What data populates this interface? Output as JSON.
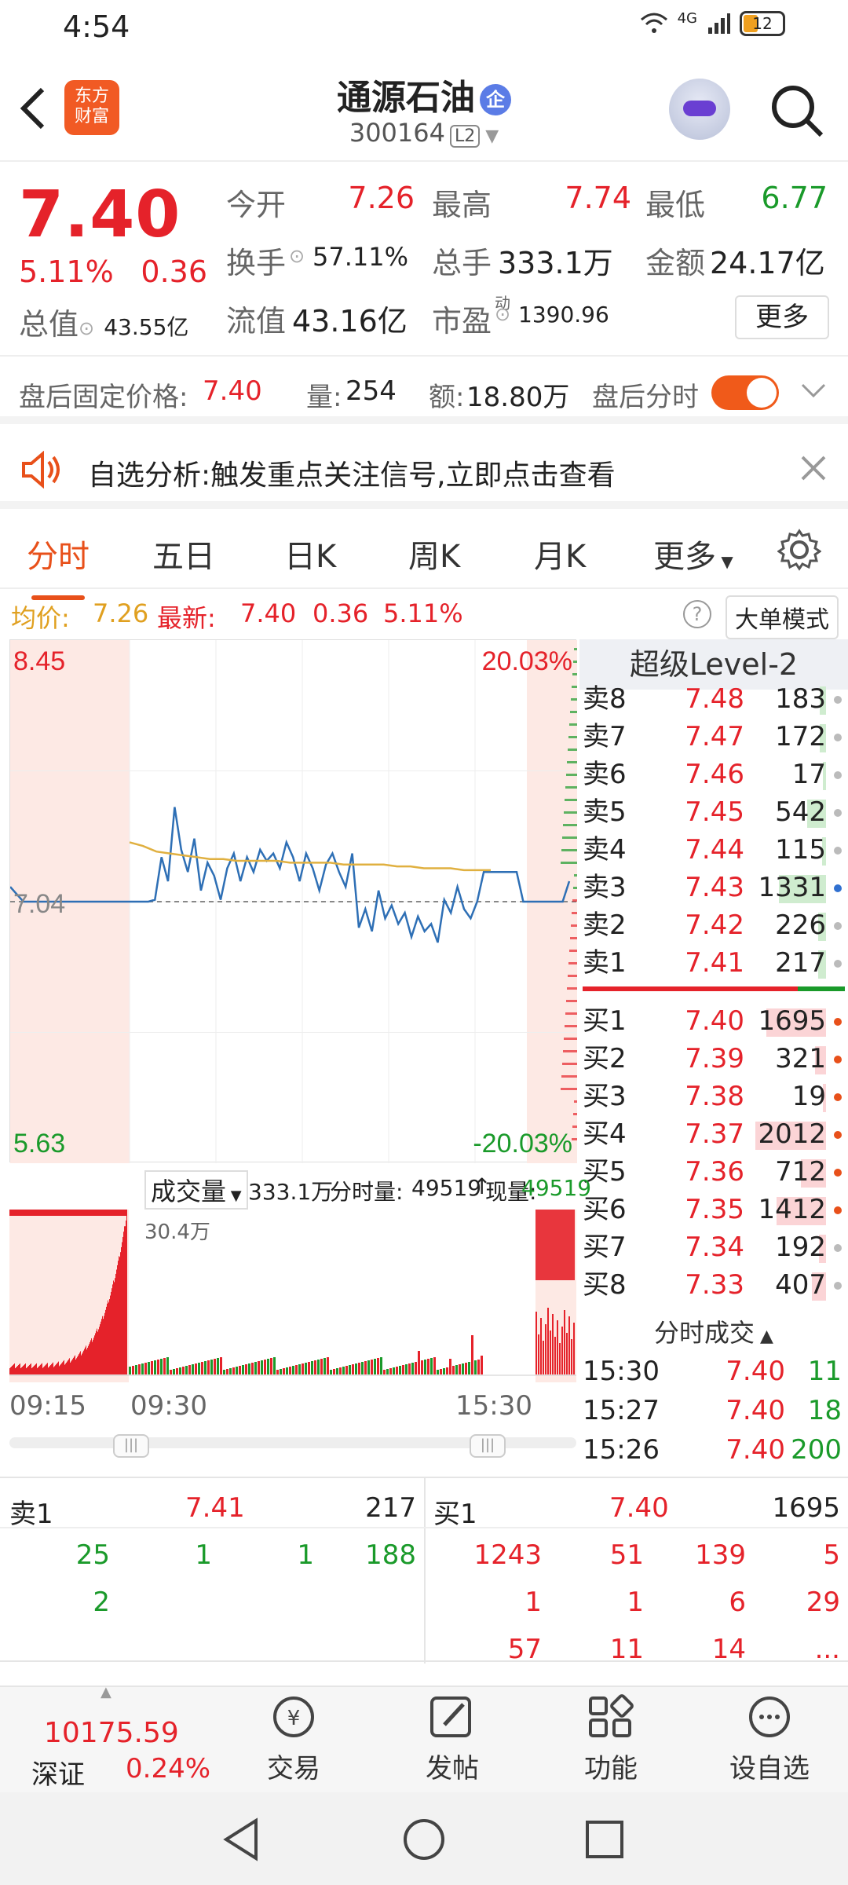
{
  "status": {
    "time": "4:54",
    "network": "4G",
    "battery": "12"
  },
  "header": {
    "logo": "东方\n财富",
    "name": "通源石油",
    "name_badge": "企",
    "code": "300164",
    "level": "L2"
  },
  "quote": {
    "price": "7.40",
    "pct": "5.11%",
    "chg": "0.36",
    "total_value_label": "总值",
    "total_value": "43.55亿",
    "open_label": "今开",
    "open": "7.26",
    "high_label": "最高",
    "high": "7.74",
    "low_label": "最低",
    "low": "6.77",
    "turnover_label": "换手",
    "turnover": "57.11%",
    "volume_label": "总手",
    "volume": "333.1万",
    "amount_label": "金额",
    "amount": "24.17亿",
    "float_label": "流值",
    "float": "43.16亿",
    "pe_label": "市盈",
    "pe_sup": "动",
    "pe": "1390.96",
    "more": "更多"
  },
  "after_hours": {
    "label": "盘后固定价格:",
    "price": "7.40",
    "vol_label": "量:",
    "vol": "254",
    "amt_label": "额:",
    "amt": "18.80万",
    "switch_label": "盘后分时"
  },
  "alert": {
    "text": "自选分析:触发重点关注信号,立即点击查看"
  },
  "tabs": [
    "分时",
    "五日",
    "日K",
    "周K",
    "月K",
    "更多"
  ],
  "info": {
    "avg_label": "均价:",
    "avg": "7.26",
    "latest_label": "最新:",
    "latest": "7.40",
    "chg": "0.36",
    "pct": "5.11%",
    "big_mode": "大单模式"
  },
  "chart_data": {
    "type": "line",
    "ylim": [
      5.63,
      8.45
    ],
    "y_top_label": "8.45",
    "y_bottom_label": "5.63",
    "base_label": "7.04",
    "top_pct": "20.03%",
    "bottom_pct": "-20.03%",
    "x_labels": [
      "09:15",
      "09:30",
      "15:30"
    ],
    "series": [
      {
        "values": [
          7.12,
          7.08,
          7.04,
          7.04,
          7.04,
          7.04,
          7.04,
          7.04,
          7.04,
          7.04,
          7.04,
          7.04,
          7.04,
          7.04,
          7.04,
          7.04,
          7.04,
          7.04,
          7.04,
          7.04,
          7.04,
          7.04,
          7.05,
          7.28,
          7.15,
          7.55,
          7.32,
          7.2,
          7.38,
          7.1,
          7.25,
          7.18,
          7.05,
          7.22,
          7.3,
          7.15,
          7.28,
          7.2,
          7.32,
          7.26,
          7.3,
          7.22,
          7.36,
          7.28,
          7.15,
          7.3,
          7.22,
          7.1,
          7.24,
          7.3,
          7.2,
          7.12,
          7.3,
          6.9,
          7.0,
          6.88,
          7.1,
          6.95,
          7.02,
          6.92,
          6.98,
          6.85,
          6.96,
          6.88,
          6.92,
          6.82,
          7.05,
          6.98,
          7.12,
          7.0,
          6.95,
          7.04,
          7.2,
          7.2,
          7.2,
          7.2,
          7.2,
          7.2,
          7.04,
          7.04,
          7.04,
          7.04,
          7.04,
          7.04,
          7.04,
          7.15
        ]
      },
      {
        "values": [
          7.36,
          7.34,
          7.31,
          7.3,
          7.29,
          7.28,
          7.27,
          7.27,
          7.26,
          7.26,
          7.26,
          7.26,
          7.25,
          7.25,
          7.25,
          7.25,
          7.24,
          7.24,
          7.24,
          7.24,
          7.23,
          7.23,
          7.22,
          7.22,
          7.22,
          7.21,
          7.21,
          7.21
        ]
      }
    ]
  },
  "level2": {
    "title": "超级Level-2",
    "asks": [
      {
        "label": "卖8",
        "price": "7.48",
        "qty": "183"
      },
      {
        "label": "卖7",
        "price": "7.47",
        "qty": "172"
      },
      {
        "label": "卖6",
        "price": "7.46",
        "qty": "17"
      },
      {
        "label": "卖5",
        "price": "7.45",
        "qty": "542"
      },
      {
        "label": "卖4",
        "price": "7.44",
        "qty": "115"
      },
      {
        "label": "卖3",
        "price": "7.43",
        "qty": "1331"
      },
      {
        "label": "卖2",
        "price": "7.42",
        "qty": "226"
      },
      {
        "label": "卖1",
        "price": "7.41",
        "qty": "217"
      }
    ],
    "bids": [
      {
        "label": "买1",
        "price": "7.40",
        "qty": "1695"
      },
      {
        "label": "买2",
        "price": "7.39",
        "qty": "321"
      },
      {
        "label": "买3",
        "price": "7.38",
        "qty": "19"
      },
      {
        "label": "买4",
        "price": "7.37",
        "qty": "2012"
      },
      {
        "label": "买5",
        "price": "7.36",
        "qty": "712"
      },
      {
        "label": "买6",
        "price": "7.35",
        "qty": "1412"
      },
      {
        "label": "买7",
        "price": "7.34",
        "qty": "192"
      },
      {
        "label": "买8",
        "price": "7.33",
        "qty": "407"
      }
    ],
    "ticks_title": "分时成交",
    "ticks": [
      {
        "time": "15:30",
        "price": "7.40",
        "vol": "11"
      },
      {
        "time": "15:27",
        "price": "7.40",
        "vol": "18"
      },
      {
        "time": "15:26",
        "price": "7.40",
        "vol": "200"
      }
    ]
  },
  "volume": {
    "select": "成交量",
    "total": "333.1万",
    "tick_label": "分时量:",
    "tick": "49519",
    "now_label": "现量:",
    "now": "49519",
    "max": "30.4万"
  },
  "queue": {
    "ask_label": "卖1",
    "ask_price": "7.41",
    "ask_qty": "217",
    "bid_label": "买1",
    "bid_price": "7.40",
    "bid_qty": "1695",
    "ask_orders": [
      "25",
      "1",
      "1",
      "188",
      "2"
    ],
    "bid_orders": [
      "1243",
      "51",
      "139",
      "5",
      "1",
      "1",
      "6",
      "29",
      "57",
      "11",
      "14",
      "..."
    ]
  },
  "index": {
    "value": "10175.59",
    "name": "深证",
    "pct": "0.24%"
  },
  "nav": [
    "交易",
    "发帖",
    "功能",
    "设自选"
  ],
  "colors": {
    "up": "#e5222a",
    "down": "#1a9a2a",
    "accent": "#e8501a"
  }
}
